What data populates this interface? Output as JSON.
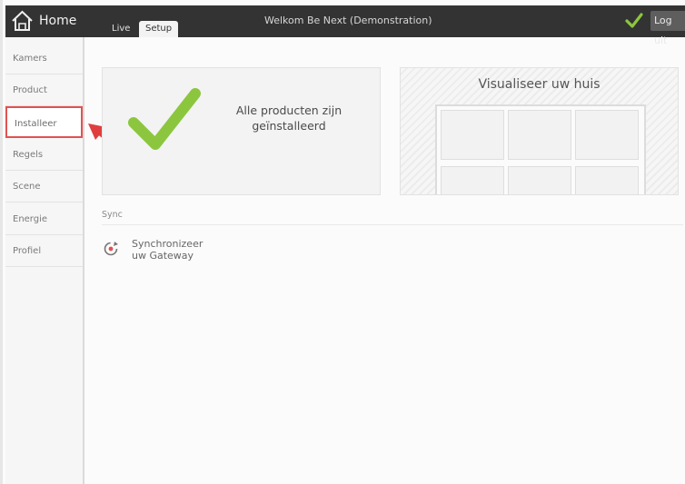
{
  "header": {
    "home_label": "Home",
    "tabs": [
      {
        "label": "Live"
      },
      {
        "label": "Setup"
      }
    ],
    "welcome": "Welkom Be Next (Demonstration)",
    "logout_label": "Log uit"
  },
  "sidebar": {
    "items": [
      {
        "label": "Kamers"
      },
      {
        "label": "Product"
      },
      {
        "label": "Installeer"
      },
      {
        "label": "Regels"
      },
      {
        "label": "Scene"
      },
      {
        "label": "Energie"
      },
      {
        "label": "Profiel"
      }
    ]
  },
  "main": {
    "installed_line1": "Alle producten zijn",
    "installed_line2": "geïnstalleerd",
    "visualize_title": "Visualiseer uw huis",
    "sync_section": "Sync",
    "sync_line1": "Synchronizeer",
    "sync_line2": "uw Gateway"
  },
  "colors": {
    "accent_green": "#8cc63f",
    "highlight_red": "#e05252",
    "topbar": "#333333"
  },
  "icons": [
    "home-icon",
    "checkmark-icon",
    "arrow-icon",
    "sync-icon"
  ]
}
